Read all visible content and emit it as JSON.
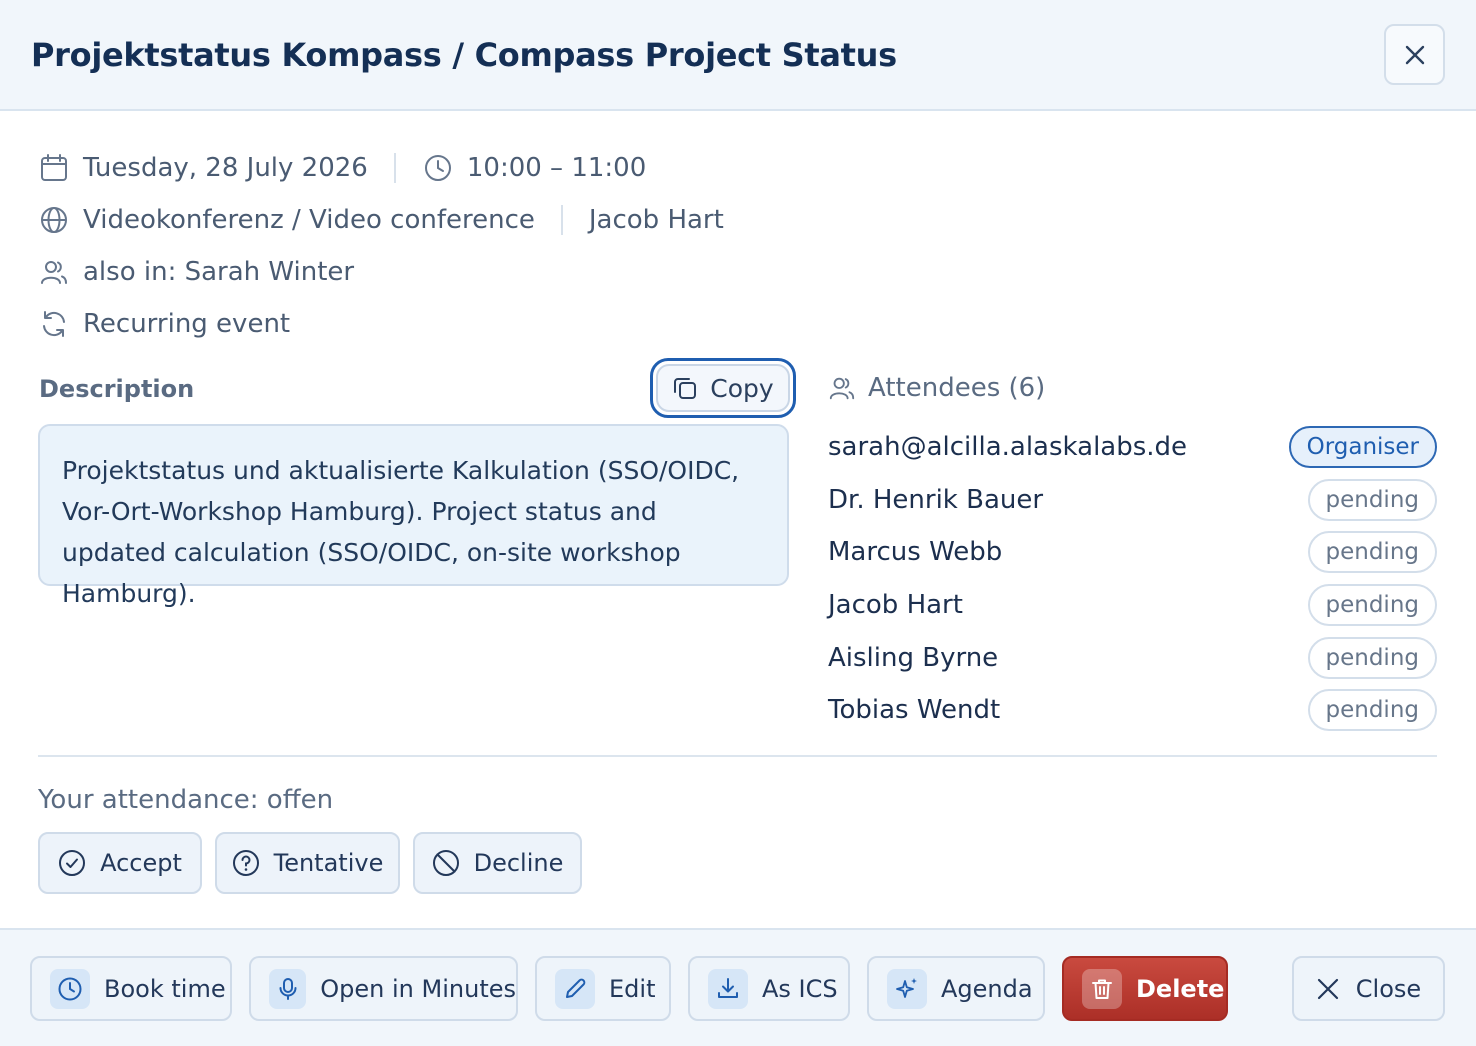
{
  "dialog": {
    "title": "Projektstatus Kompass / Compass Project Status",
    "close_icon": "close-icon"
  },
  "meta": {
    "date": "Tuesday, 28 July 2026",
    "time": "10:00 – 11:00",
    "location": "Videokonferenz / Video conference",
    "organizer": "Jacob Hart",
    "also_in": "also in: Sarah Winter",
    "recurrence": "Recurring event"
  },
  "description": {
    "label": "Description",
    "copy_label": "Copy",
    "text": "Projektstatus und aktualisierte Kalkulation (SSO/OIDC, Vor-Ort-Workshop Hamburg). Project status and updated calculation (SSO/OIDC, on-site workshop Hamburg)."
  },
  "attendees": {
    "header": "Attendees (6)",
    "list": [
      {
        "name": "sarah@alcilla.alaskalabs.de",
        "status": "Organiser"
      },
      {
        "name": "Dr. Henrik Bauer",
        "status": "pending"
      },
      {
        "name": "Marcus Webb",
        "status": "pending"
      },
      {
        "name": "Jacob Hart",
        "status": "pending"
      },
      {
        "name": "Aisling Byrne",
        "status": "pending"
      },
      {
        "name": "Tobias Wendt",
        "status": "pending"
      }
    ]
  },
  "attendance": {
    "label": "Your attendance: offen",
    "accept": "Accept",
    "tentative": "Tentative",
    "decline": "Decline"
  },
  "footer": {
    "book_time": "Book time",
    "open_in_minutes": "Open in Minutes",
    "edit": "Edit",
    "as_ics": "As ICS",
    "agenda": "Agenda",
    "delete": "Delete",
    "close": "Close"
  },
  "colors": {
    "accent": "#1f5eb0",
    "danger": "#b8352c",
    "header_bg": "#f1f6fb",
    "description_bg": "#eaf3fb"
  }
}
